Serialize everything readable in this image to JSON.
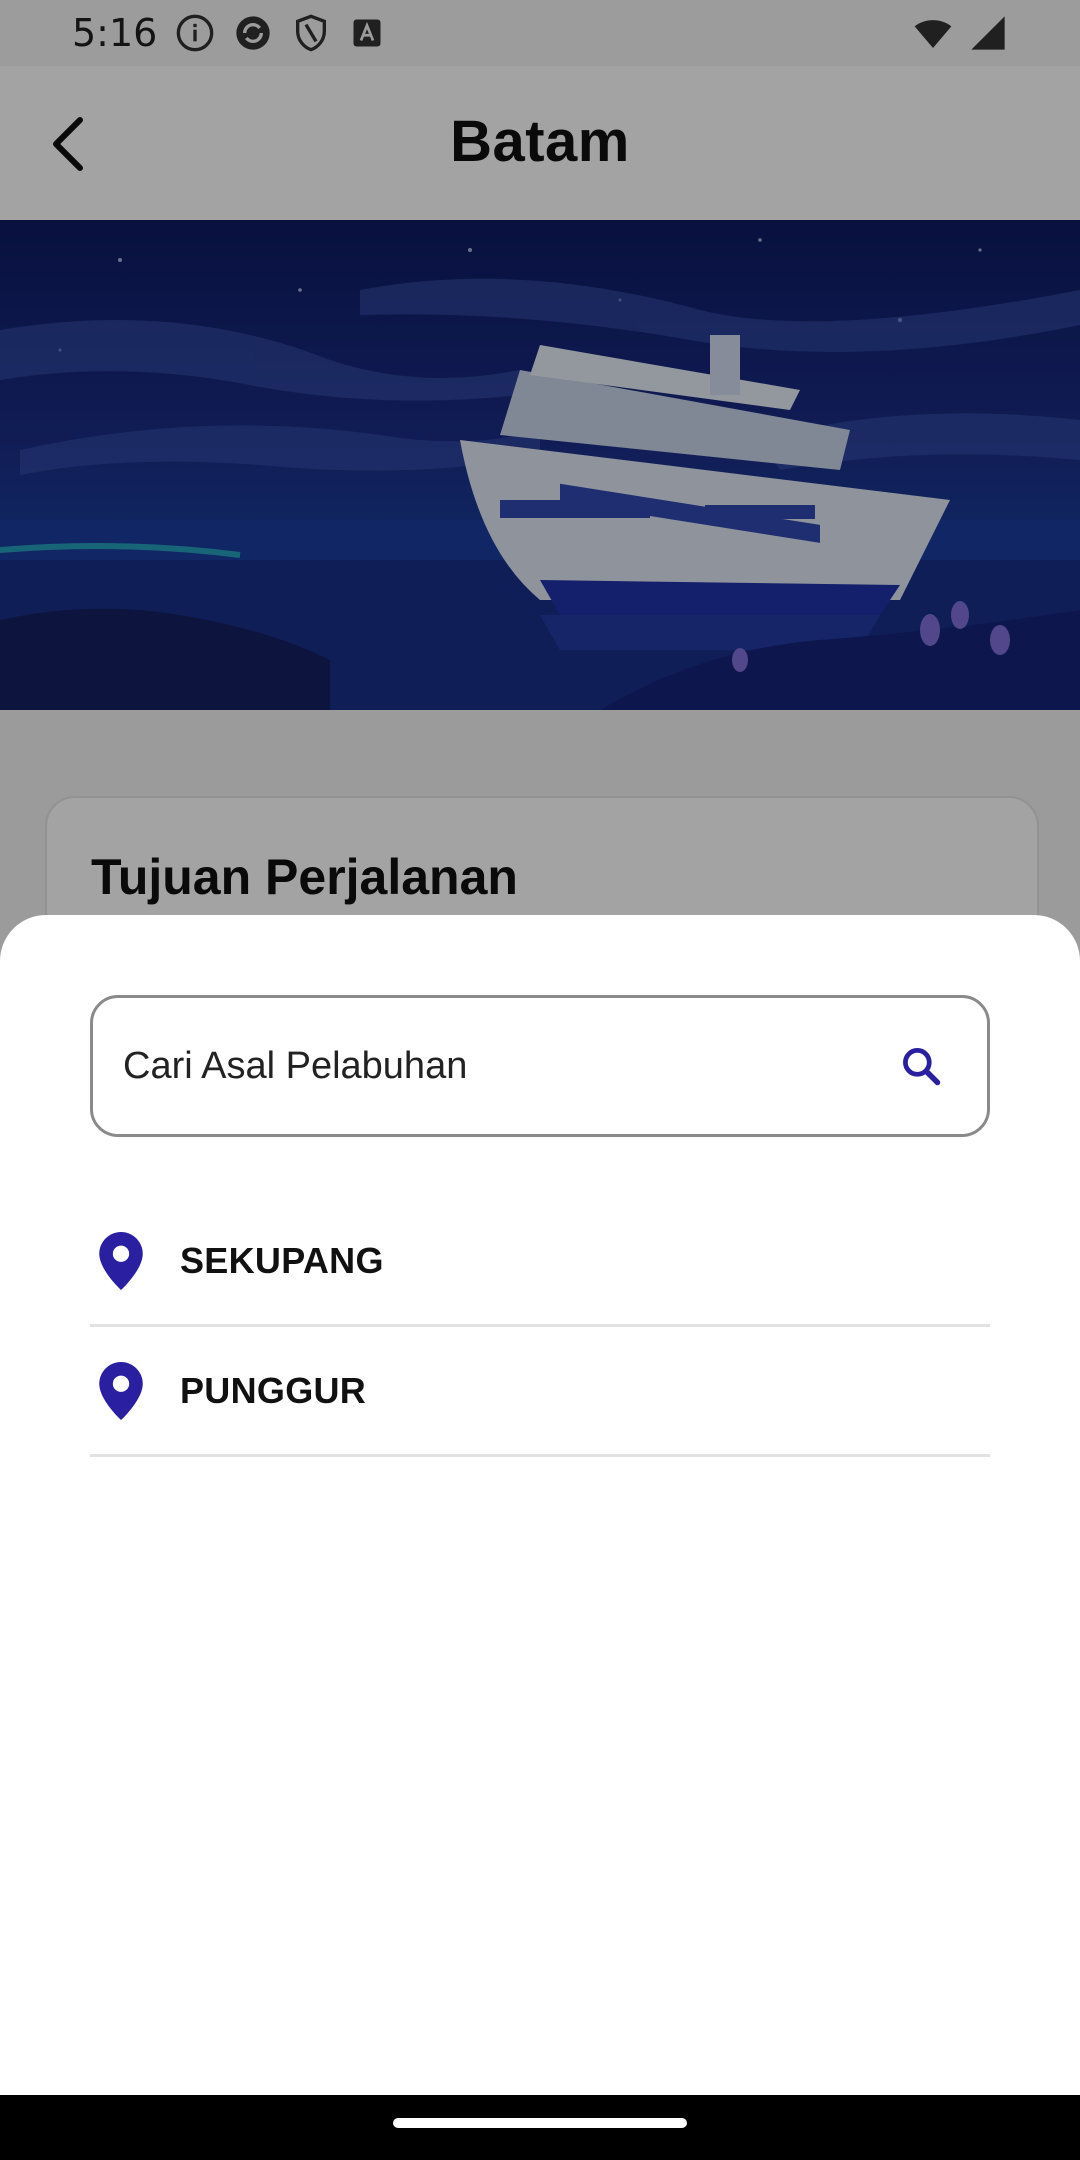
{
  "status_bar": {
    "time": "5:16"
  },
  "app_bar": {
    "title": "Batam"
  },
  "trip_card": {
    "title": "Tujuan Perjalanan"
  },
  "sheet": {
    "search": {
      "placeholder": "Cari Asal Pelabuhan",
      "value": ""
    },
    "ports": [
      {
        "label": "SEKUPANG"
      },
      {
        "label": "PUNGGUR"
      }
    ]
  },
  "icons": {
    "back": "arrow-back-icon",
    "search": "search-icon",
    "pin": "location-pin-icon"
  },
  "colors": {
    "accent": "#2a1fa0",
    "scrim": "rgba(0,0,0,0.36)"
  }
}
